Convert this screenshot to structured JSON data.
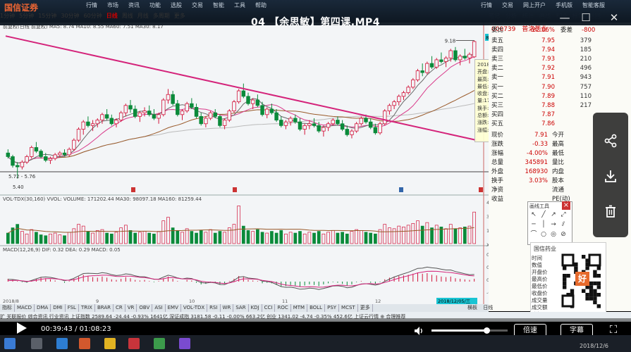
{
  "window": {
    "video_title": "04 【余思敏】第四课.MP4",
    "software_brand": "国信证券",
    "menu_left": [
      "行情",
      "市场",
      "资讯",
      "功能",
      "选股",
      "交易",
      "智能",
      "工具",
      "帮助"
    ],
    "menu_right": [
      "行情",
      "交易",
      "网上开户",
      "手机版",
      "智能客服"
    ],
    "controls": {
      "minimize": "—",
      "maximize": "☐",
      "close": "✕"
    }
  },
  "toolbar": {
    "periods": [
      "1分钟",
      "5分钟",
      "15分钟",
      "30分钟",
      "60分钟",
      "日线",
      "周线",
      "月线",
      "多周期",
      "更多"
    ],
    "active": "日线"
  },
  "side_tabs": [
    "笔记",
    "分析",
    "统计",
    "画线",
    "F10",
    "标记",
    "返回"
  ],
  "stock": {
    "code": "000739",
    "name": "普洛药业",
    "price_line_label": "9.18",
    "current_tag": "8.94"
  },
  "indicators": {
    "ma_line": "前复权(日线 前复权)  MA5: 8.74   MA10: 8.55   MA60: 7.51   MA30: 8.17",
    "ma_colors": {
      "ma5": "#6a6a6a",
      "ma10": "#d93a8a",
      "ma30": "#9a5a2a",
      "ma60": "#bbbbbb"
    },
    "low_labels": [
      "5.72",
      "5.76",
      "5.40"
    ],
    "vol_line": "VOL-TDX(30,160)  VVOL:  VOLUME: 171202.44  MA30: 98097.18  MA160: 81259.44",
    "vol_axis": [
      "45000",
      "30000",
      "15000",
      "X10"
    ],
    "macd_line": "MACD(12,26,9)  DIF: 0.32  DEA: 0.29  MACD: 0.05",
    "macd_axis": [
      "0.40",
      "0.20",
      "0.00",
      "-0.20"
    ],
    "date_labels": [
      "2018/8",
      "9",
      "10",
      "11",
      "12"
    ],
    "date_right": "2018/12/05/三"
  },
  "popup": {
    "date": "2018/12/05/三",
    "rows": [
      "开盘:8.73",
      "最高:9.18",
      "最低:8.70",
      "收盘:9.15",
      "量:171202",
      "换手:1.49%(自由流)",
      "总额:1.55亿",
      "涨跌:0.27",
      "涨幅:3.04%"
    ]
  },
  "quote": {
    "header": {
      "label": "委比",
      "value": "-22.06%",
      "label2": "委差",
      "value2": "-800"
    },
    "asks": [
      {
        "label": "卖五",
        "price": "7.95",
        "vol": "379"
      },
      {
        "label": "卖四",
        "price": "7.94",
        "vol": "185"
      },
      {
        "label": "卖三",
        "price": "7.93",
        "vol": "210"
      },
      {
        "label": "卖二",
        "price": "7.92",
        "vol": "496"
      },
      {
        "label": "卖一",
        "price": "7.91",
        "vol": "943"
      }
    ],
    "bids": [
      {
        "label": "买一",
        "price": "7.90",
        "vol": "757"
      },
      {
        "label": "买二",
        "price": "7.89",
        "vol": "110"
      },
      {
        "label": "买三",
        "price": "7.88",
        "vol": "217"
      },
      {
        "label": "买四",
        "price": "7.87",
        "vol": ""
      },
      {
        "label": "买五",
        "price": "7.86",
        "vol": ""
      }
    ],
    "stats": [
      {
        "l1": "现价",
        "v1": "7.91",
        "l2": "今开",
        "v2": ""
      },
      {
        "l1": "涨跌",
        "v1": "-0.33",
        "l2": "最高",
        "v2": ""
      },
      {
        "l1": "涨幅",
        "v1": "-4.00%",
        "l2": "最低",
        "v2": ""
      },
      {
        "l1": "总量",
        "v1": "345891",
        "l2": "量比",
        "v2": ""
      },
      {
        "l1": "外盘",
        "v1": "168930",
        "l2": "内盘",
        "v2": ""
      },
      {
        "l1": "换手",
        "v1": "3.03%",
        "l2": "股本",
        "v2": ""
      },
      {
        "l1": "净资",
        "v1": "",
        "l2": "流通",
        "v2": ""
      },
      {
        "l1": "收益",
        "v1": "",
        "l2": "PE(动)",
        "v2": ""
      }
    ]
  },
  "draw_panel": {
    "title": "画线工具",
    "close": "×"
  },
  "qr_panel": {
    "title": "国信药业",
    "labels": [
      "时间",
      "数值",
      "开盘价",
      "最高价",
      "最低价",
      "收盘价",
      "成交量",
      "成交额",
      "涨幅"
    ],
    "badge": "好"
  },
  "bottom_tabs": [
    "指标",
    "MACD",
    "DMA",
    "DMI",
    "FSL",
    "TRIX",
    "BRAR",
    "CR",
    "VR",
    "OBV",
    "ASI",
    "EMV",
    "VOL-TDX",
    "RSI",
    "WR",
    "SAR",
    "KDJ",
    "CCI",
    "ROC",
    "MTM",
    "BOLL",
    "PSY",
    "MCST",
    "更多"
  ],
  "bottom_right_tabs": [
    "横板",
    "日线"
  ],
  "statusbar": "扩  关联报价  综合资讯  行业资讯    上证指数 2589.64 -24.44 -0.93% 1641亿  深证成指 3181.58 -0.11 -0.00% 663.2亿  创业 1341.02 -4.74 -0.35% 452.6亿    上证云行情  ⊕ 合理推荐",
  "player": {
    "current": "00:39:43",
    "total": "01:08:23",
    "time_sep": "/",
    "progress": 0.58,
    "volume": 0.72,
    "speed_label": "倍速",
    "subtitle_label": "字幕",
    "fullscreen_label": "⛶"
  },
  "share_panel": {
    "share_icon": "share-icon",
    "download_icon": "download-icon",
    "delete_icon": "trash-icon"
  },
  "taskbar": {
    "date": "2018/12/6"
  },
  "chart_data": {
    "type": "candlestick",
    "description_dates": [
      "2018/8",
      "2018/9",
      "2018/10",
      "2018/11",
      "2018/12"
    ],
    "ylim": [
      5.2,
      9.4
    ],
    "candles": [
      [
        6.1,
        6.2,
        5.95,
        6.0
      ],
      [
        6.0,
        6.05,
        5.7,
        5.76
      ],
      [
        5.76,
        5.85,
        5.4,
        5.72
      ],
      [
        5.72,
        5.9,
        5.65,
        5.85
      ],
      [
        5.85,
        6.05,
        5.8,
        6.0
      ],
      [
        6.0,
        6.3,
        5.95,
        6.25
      ],
      [
        6.25,
        6.4,
        6.1,
        6.15
      ],
      [
        6.15,
        6.2,
        5.95,
        6.0
      ],
      [
        6.0,
        6.1,
        5.85,
        5.9
      ],
      [
        5.9,
        6.0,
        5.8,
        5.95
      ],
      [
        5.95,
        6.1,
        5.9,
        6.05
      ],
      [
        6.05,
        6.15,
        5.98,
        6.1
      ],
      [
        6.1,
        6.2,
        6.0,
        6.05
      ],
      [
        6.05,
        6.25,
        6.0,
        6.2
      ],
      [
        6.2,
        6.5,
        6.15,
        6.45
      ],
      [
        6.45,
        6.8,
        6.4,
        6.75
      ],
      [
        6.75,
        7.0,
        6.6,
        6.95
      ],
      [
        6.95,
        7.1,
        6.8,
        6.85
      ],
      [
        6.85,
        7.0,
        6.7,
        6.9
      ],
      [
        6.9,
        7.05,
        6.8,
        7.0
      ],
      [
        7.0,
        7.2,
        6.9,
        7.15
      ],
      [
        7.15,
        7.3,
        7.0,
        7.05
      ],
      [
        7.05,
        7.15,
        6.85,
        6.9
      ],
      [
        6.9,
        7.05,
        6.8,
        7.0
      ],
      [
        7.0,
        7.25,
        6.95,
        7.2
      ],
      [
        7.2,
        7.45,
        7.1,
        7.4
      ],
      [
        7.4,
        7.55,
        7.2,
        7.3
      ],
      [
        7.3,
        7.4,
        7.05,
        7.1
      ],
      [
        7.1,
        7.25,
        6.95,
        7.2
      ],
      [
        7.2,
        7.35,
        7.1,
        7.25
      ],
      [
        7.25,
        7.4,
        7.1,
        7.15
      ],
      [
        7.15,
        7.3,
        7.0,
        7.05
      ],
      [
        7.05,
        7.2,
        6.9,
        7.15
      ],
      [
        7.15,
        7.6,
        7.1,
        7.55
      ],
      [
        7.55,
        7.85,
        7.45,
        7.7
      ],
      [
        7.7,
        7.8,
        7.4,
        7.45
      ],
      [
        7.45,
        7.55,
        7.1,
        7.15
      ],
      [
        7.15,
        7.3,
        7.0,
        7.25
      ],
      [
        7.25,
        7.5,
        7.2,
        7.45
      ],
      [
        7.45,
        7.6,
        7.3,
        7.35
      ],
      [
        7.35,
        7.45,
        7.05,
        7.1
      ],
      [
        7.1,
        7.2,
        6.85,
        6.9
      ],
      [
        6.9,
        7.1,
        6.8,
        7.05
      ],
      [
        7.05,
        7.25,
        7.0,
        7.2
      ],
      [
        7.2,
        7.3,
        7.05,
        7.1
      ],
      [
        7.1,
        7.15,
        6.8,
        6.85
      ],
      [
        6.85,
        7.05,
        6.75,
        7.0
      ],
      [
        7.0,
        7.3,
        6.95,
        7.25
      ],
      [
        7.25,
        7.55,
        7.2,
        7.5
      ],
      [
        7.5,
        7.85,
        7.45,
        7.8
      ],
      [
        7.8,
        8.0,
        7.6,
        7.65
      ],
      [
        7.65,
        7.75,
        7.4,
        7.45
      ],
      [
        7.45,
        7.6,
        7.3,
        7.55
      ],
      [
        7.55,
        7.7,
        7.35,
        7.4
      ],
      [
        7.4,
        7.5,
        7.1,
        7.15
      ],
      [
        7.15,
        7.35,
        7.05,
        7.3
      ],
      [
        7.3,
        7.45,
        7.15,
        7.2
      ],
      [
        7.2,
        7.3,
        6.95,
        7.0
      ],
      [
        7.0,
        7.1,
        6.8,
        6.85
      ],
      [
        6.85,
        7.0,
        6.75,
        6.95
      ],
      [
        6.95,
        7.1,
        6.85,
        7.05
      ],
      [
        7.05,
        7.15,
        6.9,
        6.95
      ],
      [
        6.95,
        7.05,
        6.7,
        6.75
      ],
      [
        6.75,
        6.9,
        6.6,
        6.85
      ],
      [
        6.85,
        7.0,
        6.75,
        6.9
      ],
      [
        6.9,
        7.05,
        6.8,
        6.85
      ],
      [
        6.85,
        6.95,
        6.65,
        6.7
      ],
      [
        6.7,
        6.85,
        6.55,
        6.8
      ],
      [
        6.8,
        6.95,
        6.7,
        6.9
      ],
      [
        6.9,
        7.05,
        6.85,
        7.0
      ],
      [
        7.0,
        7.1,
        6.85,
        6.9
      ],
      [
        6.9,
        7.0,
        6.7,
        6.75
      ],
      [
        6.75,
        6.85,
        6.55,
        6.6
      ],
      [
        6.6,
        6.75,
        6.5,
        6.7
      ],
      [
        6.7,
        6.95,
        6.65,
        6.9
      ],
      [
        6.9,
        7.1,
        6.85,
        7.05
      ],
      [
        7.05,
        7.15,
        6.9,
        6.95
      ],
      [
        6.95,
        7.05,
        6.75,
        6.8
      ],
      [
        6.8,
        6.9,
        6.6,
        6.65
      ],
      [
        6.65,
        6.95,
        6.6,
        6.9
      ],
      [
        6.9,
        7.3,
        6.85,
        7.25
      ],
      [
        7.25,
        7.45,
        7.15,
        7.4
      ],
      [
        7.4,
        7.55,
        7.3,
        7.5
      ],
      [
        7.5,
        7.7,
        7.4,
        7.65
      ],
      [
        7.65,
        7.8,
        7.55,
        7.75
      ],
      [
        7.75,
        7.95,
        7.7,
        7.9
      ],
      [
        7.9,
        8.15,
        7.85,
        8.1
      ],
      [
        8.1,
        8.4,
        8.05,
        8.35
      ],
      [
        8.35,
        8.55,
        8.2,
        8.3
      ],
      [
        8.3,
        8.6,
        8.25,
        8.55
      ],
      [
        8.55,
        8.75,
        8.4,
        8.45
      ],
      [
        8.45,
        8.7,
        8.4,
        8.65
      ],
      [
        8.65,
        8.85,
        8.55,
        8.6
      ],
      [
        8.6,
        8.75,
        8.45,
        8.7
      ],
      [
        8.7,
        8.95,
        8.6,
        8.9
      ],
      [
        8.9,
        9.0,
        8.6,
        8.65
      ],
      [
        8.65,
        8.8,
        8.5,
        8.75
      ],
      [
        8.75,
        8.95,
        8.65,
        8.7
      ],
      [
        8.7,
        8.85,
        8.55,
        8.8
      ],
      [
        8.73,
        9.18,
        8.7,
        9.15
      ]
    ],
    "trendline": [
      [
        0,
        9.3
      ],
      [
        100,
        6.45
      ]
    ],
    "volumes": [
      12,
      18,
      22,
      14,
      11,
      16,
      13,
      10,
      9,
      11,
      12,
      10,
      9,
      13,
      17,
      22,
      20,
      14,
      12,
      15,
      16,
      12,
      11,
      13,
      18,
      21,
      15,
      12,
      13,
      14,
      12,
      11,
      14,
      26,
      30,
      18,
      15,
      13,
      17,
      14,
      12,
      15,
      13,
      16,
      12,
      14,
      13,
      18,
      22,
      43,
      20,
      15,
      14,
      16,
      13,
      12,
      14,
      12,
      15,
      11,
      13,
      12,
      14,
      11,
      13,
      12,
      14,
      11,
      13,
      15,
      12,
      13,
      11,
      14,
      16,
      15,
      13,
      12,
      11,
      16,
      22,
      18,
      17,
      20,
      19,
      21,
      23,
      26,
      20,
      24,
      18,
      21,
      19,
      17,
      22,
      17,
      18,
      19,
      20,
      36
    ],
    "macd_bars": [
      0.05,
      0.03,
      0.01,
      -0.01,
      -0.02,
      0.02,
      0.05,
      0.07,
      0.06,
      0.04,
      0.02,
      0.0,
      -0.02,
      0.01,
      0.05,
      0.09,
      0.12,
      0.1,
      0.08,
      0.07,
      0.09,
      0.07,
      0.04,
      0.03,
      0.05,
      0.08,
      0.06,
      0.03,
      0.02,
      0.03,
      0.01,
      -0.01,
      0.01,
      0.06,
      0.09,
      0.05,
      0.01,
      0.0,
      0.03,
      0.02,
      -0.02,
      -0.05,
      -0.04,
      -0.01,
      -0.02,
      -0.05,
      -0.04,
      0.01,
      0.05,
      0.1,
      0.08,
      0.03,
      0.02,
      0.01,
      -0.03,
      -0.02,
      -0.03,
      -0.06,
      -0.09,
      -0.08,
      -0.06,
      -0.07,
      -0.09,
      -0.07,
      -0.05,
      -0.06,
      -0.08,
      -0.05,
      -0.03,
      -0.01,
      -0.02,
      -0.04,
      -0.07,
      -0.05,
      -0.01,
      0.01,
      0.0,
      -0.02,
      -0.04,
      -0.01,
      0.04,
      0.07,
      0.09,
      0.1,
      0.11,
      0.12,
      0.14,
      0.16,
      0.14,
      0.15,
      0.12,
      0.11,
      0.09,
      0.08,
      0.09,
      0.06,
      0.05,
      0.04,
      0.03,
      0.05
    ]
  }
}
